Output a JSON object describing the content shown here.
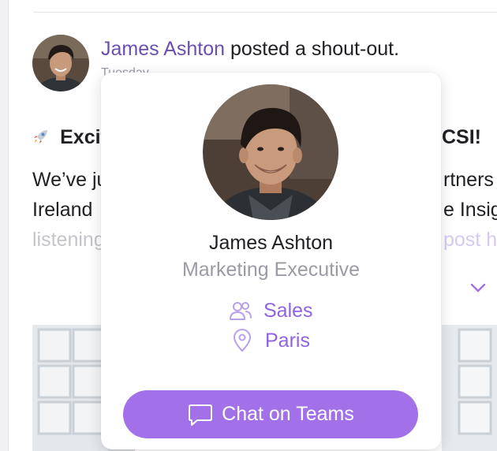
{
  "post": {
    "author": "James Ashton",
    "action": "posted a shout-out.",
    "meta": "Tuesday",
    "title_start": "Excit",
    "title_end": "CSI!",
    "body_line1_left": "We’ve ju",
    "body_line1_right": "rtners",
    "body_line2_left": "Ireland",
    "body_line2_right": "e Insig",
    "body_line3_left": "listening",
    "body_line3_right": "post he"
  },
  "profile_card": {
    "name": "James Ashton",
    "role": "Marketing Executive",
    "department": "Sales",
    "location": "Paris",
    "chat_button": "Chat on Teams"
  },
  "icons": {
    "title": "rocket-icon",
    "department": "people-icon",
    "location": "location-pin-icon",
    "chat": "chat-bubble-icon",
    "expand": "chevron-down-icon"
  },
  "colors": {
    "accent": "#a271ea",
    "link": "#6b4fb0",
    "secondary_text": "#9b9ba6"
  }
}
